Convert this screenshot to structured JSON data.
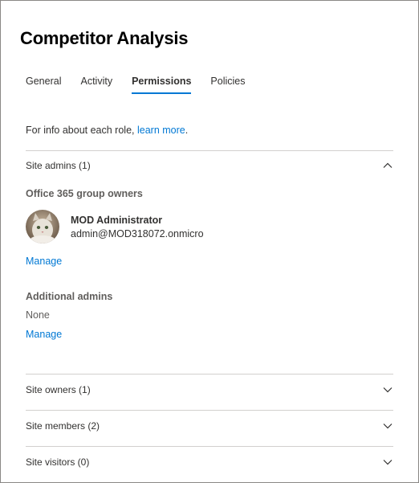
{
  "header": {
    "title": "Competitor Analysis"
  },
  "tabs": [
    {
      "label": "General",
      "active": false
    },
    {
      "label": "Activity",
      "active": false
    },
    {
      "label": "Permissions",
      "active": true
    },
    {
      "label": "Policies",
      "active": false
    }
  ],
  "info": {
    "text": "For info about each role, ",
    "link": "learn more",
    "suffix": "."
  },
  "site_admins": {
    "label": "Site admins (1)",
    "expanded": true,
    "group_owners_heading": "Office 365 group owners",
    "owner": {
      "name": "MOD Administrator",
      "email": "admin@MOD318072.onmicro",
      "avatar": "user-avatar-photo"
    },
    "manage_1": "Manage",
    "additional_heading": "Additional admins",
    "additional_value": "None",
    "manage_2": "Manage"
  },
  "sections": [
    {
      "label": "Site owners (1)",
      "expanded": false
    },
    {
      "label": "Site members (2)",
      "expanded": false
    },
    {
      "label": "Site visitors (0)",
      "expanded": false
    }
  ],
  "colors": {
    "accent": "#0078d4",
    "text": "#323130",
    "muted": "#605e5c",
    "divider": "#d2d0ce"
  }
}
